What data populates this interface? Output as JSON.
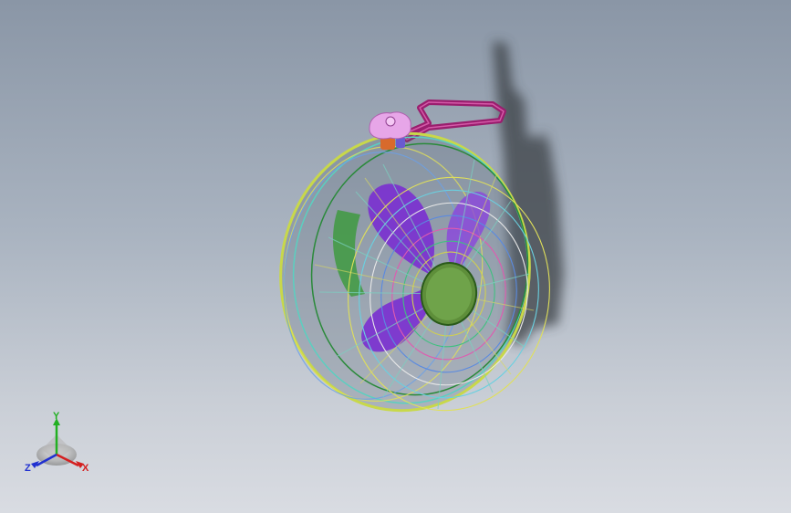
{
  "viewport": {
    "background_top": "#8a96a6",
    "background_bottom": "#d9dce2"
  },
  "model": {
    "subject": "wall-mounted-fan",
    "hub_color": "#6fa34a",
    "blade_color": "#7a2fd0",
    "bracket_color": "#9a1e6e",
    "knob_color": "#e7a6e8",
    "clamp_color": "#d86a2c"
  },
  "triad": {
    "x_label": "X",
    "y_label": "Y",
    "z_label": "Z",
    "x_color": "#d42020",
    "y_color": "#22b022",
    "z_color": "#2030d0"
  }
}
